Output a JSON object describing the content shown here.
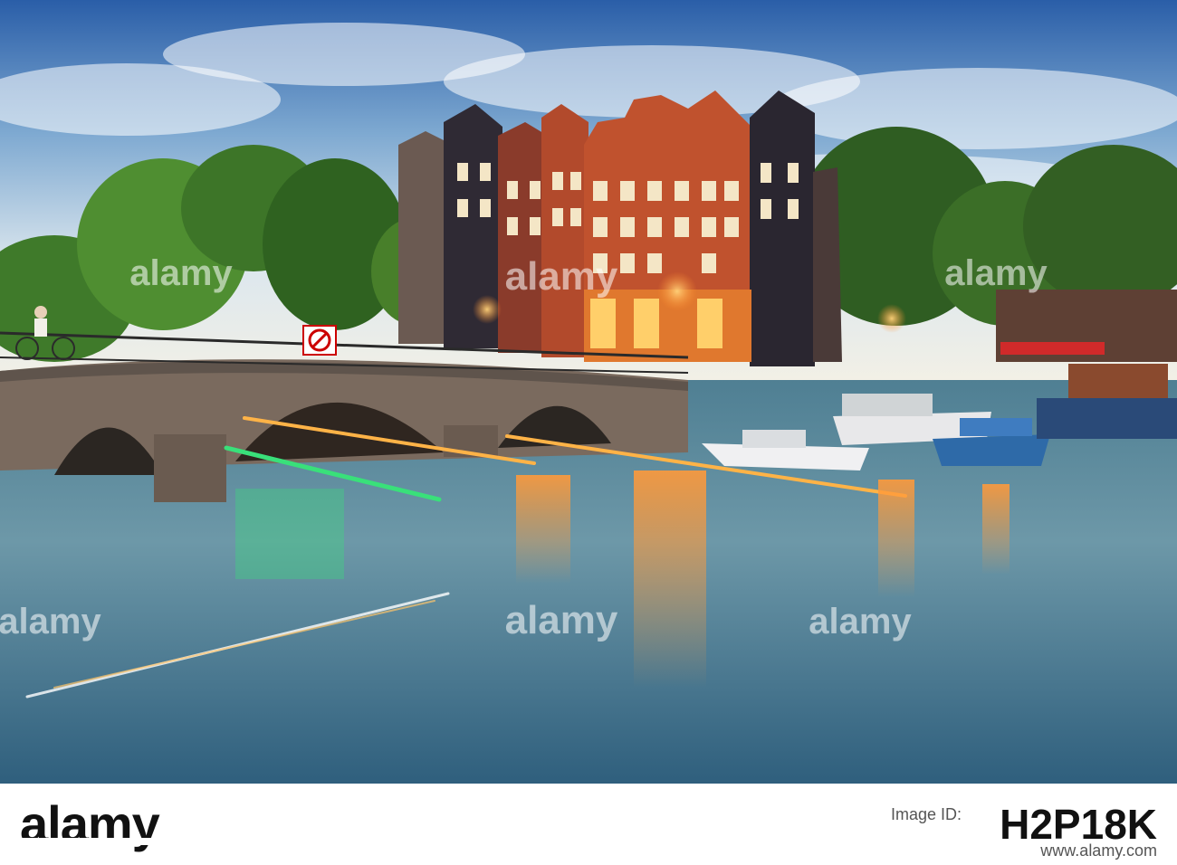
{
  "watermark": {
    "text": "alamy"
  },
  "footer": {
    "logo_text": "alamy",
    "image_id_label": "Image ID:",
    "image_id": "H2P18K",
    "url": "www.alamy.com"
  },
  "colors": {
    "sky_top": "#2f6fb5",
    "sky_horizon": "#e6eef2",
    "water": "#5a8fa6",
    "brick": "#b84a2e",
    "light_trail_orange": "#ffb347",
    "light_trail_green": "#39e07a"
  }
}
